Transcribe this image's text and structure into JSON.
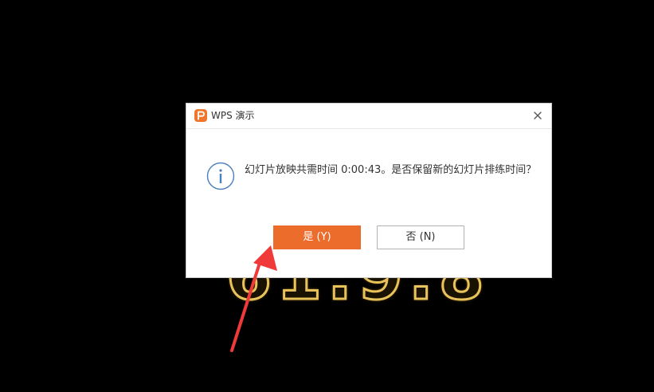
{
  "background": {
    "slide_text": "61:9:8"
  },
  "dialog": {
    "title": "WPS 演示",
    "app_icon": "wps-presentation-icon",
    "close_icon": "close-icon",
    "info_icon": "info-icon",
    "message": "幻灯片放映共需时间 0:00:43。是否保留新的幻灯片排练时间？",
    "buttons": {
      "yes_label": "是 (Y)",
      "no_label": "否 (N)"
    }
  },
  "colors": {
    "accent": "#ec6d2b",
    "annotation_arrow": "#f03a3a"
  }
}
